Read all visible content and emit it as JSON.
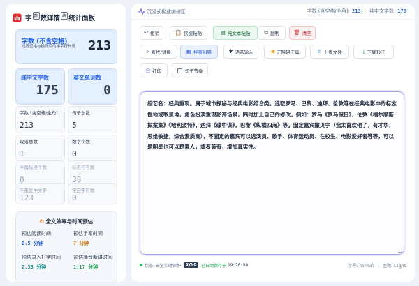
{
  "sidebar": {
    "title_a": "字",
    "title_sup_a": "数",
    "title_b": "数详情",
    "title_sup_b": "统",
    "title_c": "统计面板",
    "hero": {
      "label": "字数 (不含空格)",
      "sub": "过滤空格与换行后的净字符长度",
      "value": "213"
    },
    "cjk": {
      "label": "纯中文字数",
      "value": "175"
    },
    "en_words": {
      "label": "英文单词数",
      "value": "0"
    },
    "stats": [
      {
        "label": "字数 (含空格/全角)",
        "value": "213"
      },
      {
        "label": "句子总数",
        "value": "5"
      },
      {
        "label": "段落总数",
        "value": "1"
      },
      {
        "label": "数字个数",
        "value": "0"
      },
      {
        "label": "半角标点个数",
        "value": "0"
      },
      {
        "label": "标点符号数",
        "value": "38"
      },
      {
        "label": "不重复中文字",
        "value": "123"
      },
      {
        "label": "空白字符数",
        "value": "0"
      }
    ],
    "efficiency": {
      "title": "全文效率与时间预估",
      "items": [
        {
          "label": "预估阅读时间",
          "value": "0.5 分钟",
          "color": "#2563eb"
        },
        {
          "label": "预估手写时间",
          "value": "7 分钟",
          "color": "#d97706"
        },
        {
          "label": "预估录入打字时间",
          "value": "2.33 分钟",
          "color": "#0d9488"
        },
        {
          "label": "预估播音新讲时间",
          "value": "1.17 分钟",
          "color": "#16a34a"
        }
      ]
    }
  },
  "header": {
    "title": "沉浸式极速编辑区",
    "count_label": "字数 (含空格/全角):",
    "count_value": "213",
    "cjk_label": "纯中文字数:",
    "cjk_value": "175"
  },
  "toolbar": {
    "undo": "撤销",
    "quick_paste": "快捷粘贴",
    "plain_paste": "纯文本粘贴",
    "copy": "复制",
    "clear": "清空",
    "find_replace": "查找/替换",
    "typeset": "排查纠错",
    "voice": "语音输入",
    "accessibility": "无障碍工具",
    "upload": "上传文件",
    "download": "下载TXT",
    "print": "打印",
    "sentence_rhythm": "句子节奏"
  },
  "editor": {
    "text": "综艺名：经典重现。属于城市探秘与经典电影结合类。选取罗马、巴黎、迪拜、伦敦等在经典电影中的标志性地或取景地，角色扮演重现影评场景，同时加上自己的修改。例如：罗马《罗马假日》，伦敦《福尔摩斯探案集》《哈利波特》，迪拜《碟中谍》，巴黎《纵横四海》等。固定嘉宾撒贝宁（我太喜欢他了，有才华，思维敏捷，综合素质高），不固定的嘉宾可以选演员、歌手、体育运动员、在校生、电影爱好者等等，可以是明星也可以是素人，或者兼有，增加真实性。"
  },
  "footer": {
    "status": "状态: 安全实时保护",
    "sync_tag": "SYNC",
    "saved": "已自动保存于",
    "time": "19:26:50",
    "font_label": "字号:",
    "font_value": "normal",
    "theme_label": "主题:",
    "theme_value": "Light"
  }
}
